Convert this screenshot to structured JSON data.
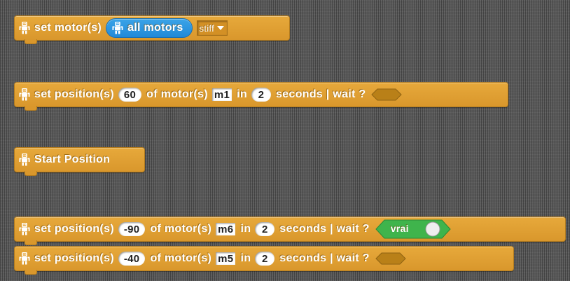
{
  "blocks": {
    "set_motors": {
      "label": "set motor(s)",
      "reporter": "all motors",
      "dropdown": "stiff"
    },
    "set_pos_1": {
      "label": "set position(s)",
      "value": "60",
      "of_label": "of motor(s)",
      "motor": "m1",
      "in_label": "in",
      "seconds": "2",
      "seconds_label": "seconds | wait ?"
    },
    "start_position": {
      "label": "Start Position"
    },
    "set_pos_2": {
      "label": "set position(s)",
      "value": "-90",
      "of_label": "of motor(s)",
      "motor": "m6",
      "in_label": "in",
      "seconds": "2",
      "seconds_label": "seconds | wait ?",
      "wait_value": "vrai"
    },
    "set_pos_3": {
      "label": "set position(s)",
      "value": "-40",
      "of_label": "of motor(s)",
      "motor": "m5",
      "in_label": "in",
      "seconds": "2",
      "seconds_label": "seconds | wait ?"
    }
  },
  "icons": {
    "block_icon": "robot-icon"
  },
  "colors": {
    "block": "#e1a031",
    "reporter": "#2d96e0",
    "boolean": "#3fb44c",
    "background": "#5c5c5c"
  }
}
